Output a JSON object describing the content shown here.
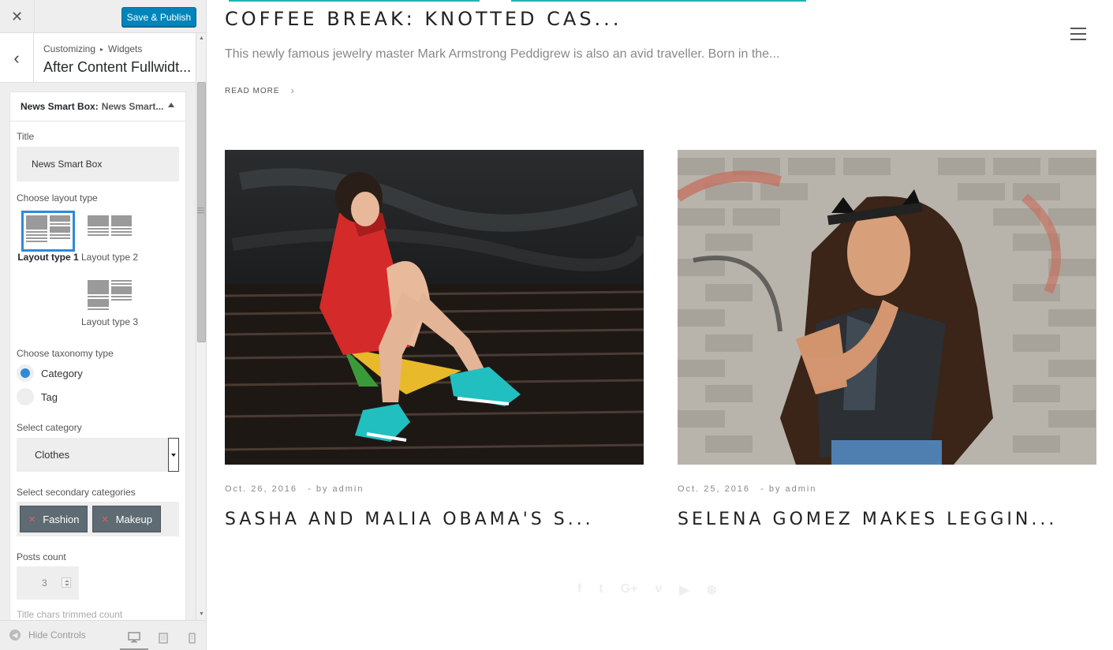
{
  "customizer": {
    "close_icon": "close-icon",
    "save_label": "Save & Publish",
    "breadcrumb_root": "Customizing",
    "breadcrumb_section": "Widgets",
    "panel_title": "After Content Fullwidt...",
    "widget": {
      "name": "News Smart Box:",
      "subtitle": "News Smart...",
      "title_label": "Title",
      "title_value": "News Smart Box",
      "layout_label": "Choose layout type",
      "layouts": [
        {
          "label": "Layout type 1",
          "selected": true
        },
        {
          "label": "Layout type 2",
          "selected": false
        },
        {
          "label": "Layout type 3",
          "selected": false
        }
      ],
      "taxonomy_label": "Choose taxonomy type",
      "taxonomy_options": [
        {
          "label": "Category",
          "checked": true
        },
        {
          "label": "Tag",
          "checked": false
        }
      ],
      "category_label": "Select category",
      "category_value": "Clothes",
      "secondary_label": "Select secondary categories",
      "secondary_chips": [
        "Fashion",
        "Makeup"
      ],
      "posts_count_label": "Posts count",
      "posts_count_value": "3",
      "chars_label": "Title chars trimmed count"
    },
    "footer": {
      "hide_controls": "Hide Controls",
      "devices": [
        "desktop-icon",
        "tablet-icon",
        "mobile-icon"
      ]
    }
  },
  "preview": {
    "top_post": {
      "title": "COFFEE BREAK: KNOTTED CAS...",
      "excerpt": "This newly famous jewelry master Mark Armstrong Peddigrew is also an avid traveller. Born in the...",
      "read_more": "READ MORE"
    },
    "cards": [
      {
        "date": "Oct. 26, 2016",
        "author": "- by admin",
        "title": "SASHA AND MALIA OBAMA'S S..."
      },
      {
        "date": "Oct. 25, 2016",
        "author": "- by admin",
        "title": "SELENA GOMEZ MAKES LEGGIN..."
      }
    ],
    "social_icons": [
      "f",
      "t",
      "G+",
      "v",
      "▶",
      "⊛"
    ],
    "colors": {
      "accent": "#20b3b6",
      "save_button": "#0085ba",
      "selection": "#2e8ad8"
    }
  }
}
